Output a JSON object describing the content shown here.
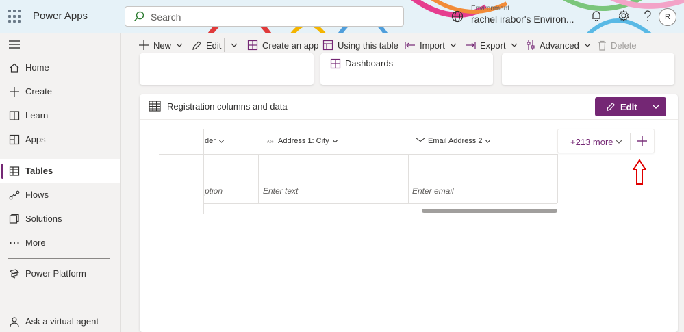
{
  "header": {
    "app_name": "Power Apps",
    "search_placeholder": "Search",
    "environment_label": "Environment",
    "environment_value": "rachel irabor's Environ...",
    "avatar_initial": "R"
  },
  "sidebar": {
    "items": [
      {
        "label": "Home",
        "icon": "home-icon"
      },
      {
        "label": "Create",
        "icon": "plus-icon"
      },
      {
        "label": "Learn",
        "icon": "book-icon"
      },
      {
        "label": "Apps",
        "icon": "apps-icon"
      },
      {
        "label": "Tables",
        "icon": "table-icon",
        "active": true
      },
      {
        "label": "Flows",
        "icon": "flow-icon"
      },
      {
        "label": "Solutions",
        "icon": "solutions-icon"
      },
      {
        "label": "More",
        "icon": "more-icon"
      }
    ],
    "power_platform": "Power Platform",
    "virtual_agent": "Ask a virtual agent"
  },
  "commands": {
    "new": "New",
    "edit": "Edit",
    "create_app": "Create an app",
    "using_table": "Using this table",
    "import": "Import",
    "export": "Export",
    "advanced": "Advanced",
    "delete": "Delete"
  },
  "cards": {
    "dashboards": "Dashboards"
  },
  "panel": {
    "title": "Registration columns and data",
    "edit_button": "Edit",
    "columns": [
      {
        "label": "der",
        "icon": ""
      },
      {
        "label": "Address 1: City",
        "icon": "text-field-icon"
      },
      {
        "label": "Email Address 2",
        "icon": "email-icon"
      }
    ],
    "placeholders": [
      "ption",
      "Enter text",
      "Enter email"
    ],
    "more_columns": "+213 more"
  },
  "colors": {
    "accent": "#742774",
    "header_bg": "#e6f2f8",
    "annotation": "#e00000"
  }
}
